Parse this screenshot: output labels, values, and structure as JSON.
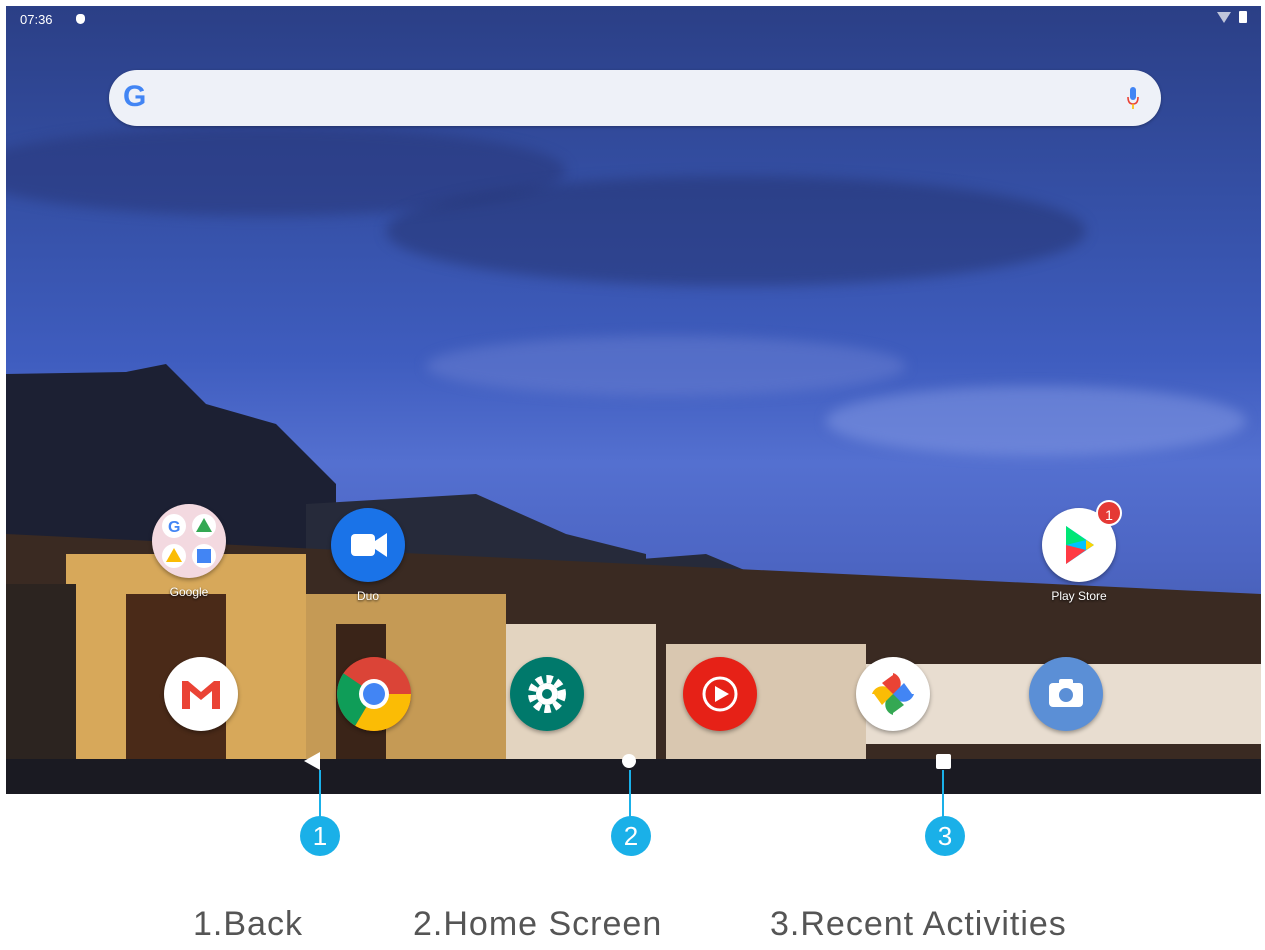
{
  "status_bar": {
    "time": "07:36"
  },
  "search": {
    "logo": "G",
    "logo_icon": "google-g-icon",
    "mic_icon": "mic-icon"
  },
  "apps_row1": [
    {
      "label": "Google",
      "icon": "google-folder-icon"
    },
    {
      "label": "Duo",
      "icon": "duo-icon"
    },
    {
      "label": "Play Store",
      "icon": "play-store-icon",
      "badge": "1"
    }
  ],
  "dock": [
    {
      "icon": "gmail-icon"
    },
    {
      "icon": "chrome-icon"
    },
    {
      "icon": "settings-icon"
    },
    {
      "icon": "youtube-music-icon"
    },
    {
      "icon": "photos-icon"
    },
    {
      "icon": "camera-icon"
    }
  ],
  "nav": {
    "back_icon": "back-icon",
    "home_icon": "home-icon",
    "recent_icon": "recent-apps-icon"
  },
  "callouts": [
    "1",
    "2",
    "3"
  ],
  "captions": [
    "1.Back",
    "2.Home Screen",
    "3.Recent Activities"
  ],
  "colors": {
    "callout": "#1ab0e8",
    "badge": "#e53935"
  }
}
